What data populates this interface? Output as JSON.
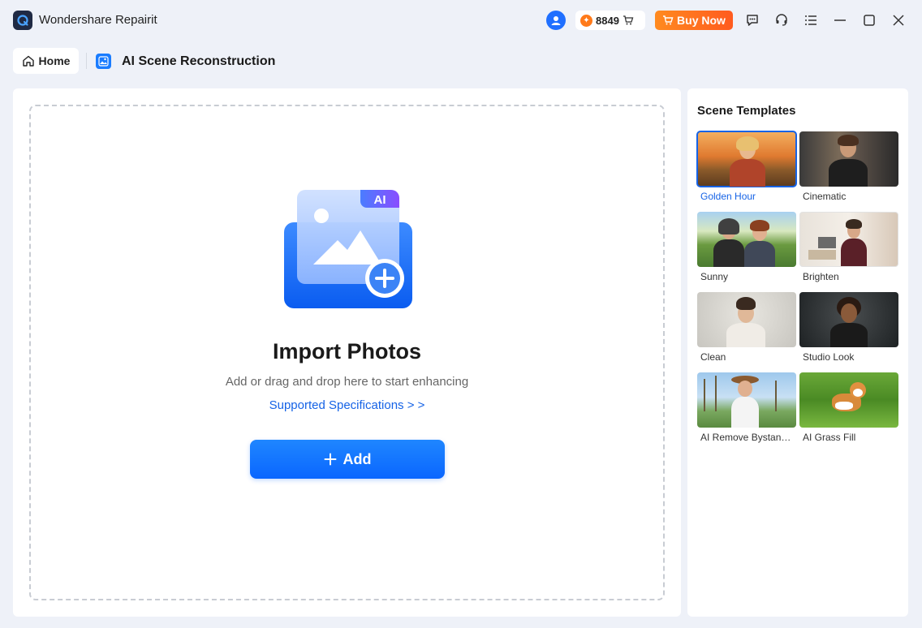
{
  "app": {
    "title": "Wondershare Repairit"
  },
  "titlebar": {
    "credits": "8849",
    "buy_label": "Buy Now",
    "icons": [
      "user-icon",
      "cart-icon",
      "feedback-icon",
      "support-icon",
      "menu-icon",
      "minimize-icon",
      "maximize-icon",
      "close-icon"
    ]
  },
  "breadcrumb": {
    "home_label": "Home",
    "page_title": "AI Scene Reconstruction"
  },
  "main": {
    "illustration_badge": "AI",
    "title": "Import Photos",
    "subtitle": "Add or drag and drop here to start enhancing",
    "spec_link": "Supported Specifications > >",
    "add_label": "Add"
  },
  "side": {
    "title": "Scene Templates",
    "templates": [
      {
        "label": "Golden Hour",
        "selected": true
      },
      {
        "label": "Cinematic",
        "selected": false
      },
      {
        "label": "Sunny",
        "selected": false
      },
      {
        "label": "Brighten",
        "selected": false
      },
      {
        "label": "Clean",
        "selected": false
      },
      {
        "label": "Studio Look",
        "selected": false
      },
      {
        "label": "AI Remove Bystand...",
        "selected": false
      },
      {
        "label": "AI Grass Fill",
        "selected": false
      }
    ]
  },
  "colors": {
    "accent": "#1663e6",
    "buy": "#ff6a1f",
    "background": "#eef1f8"
  }
}
